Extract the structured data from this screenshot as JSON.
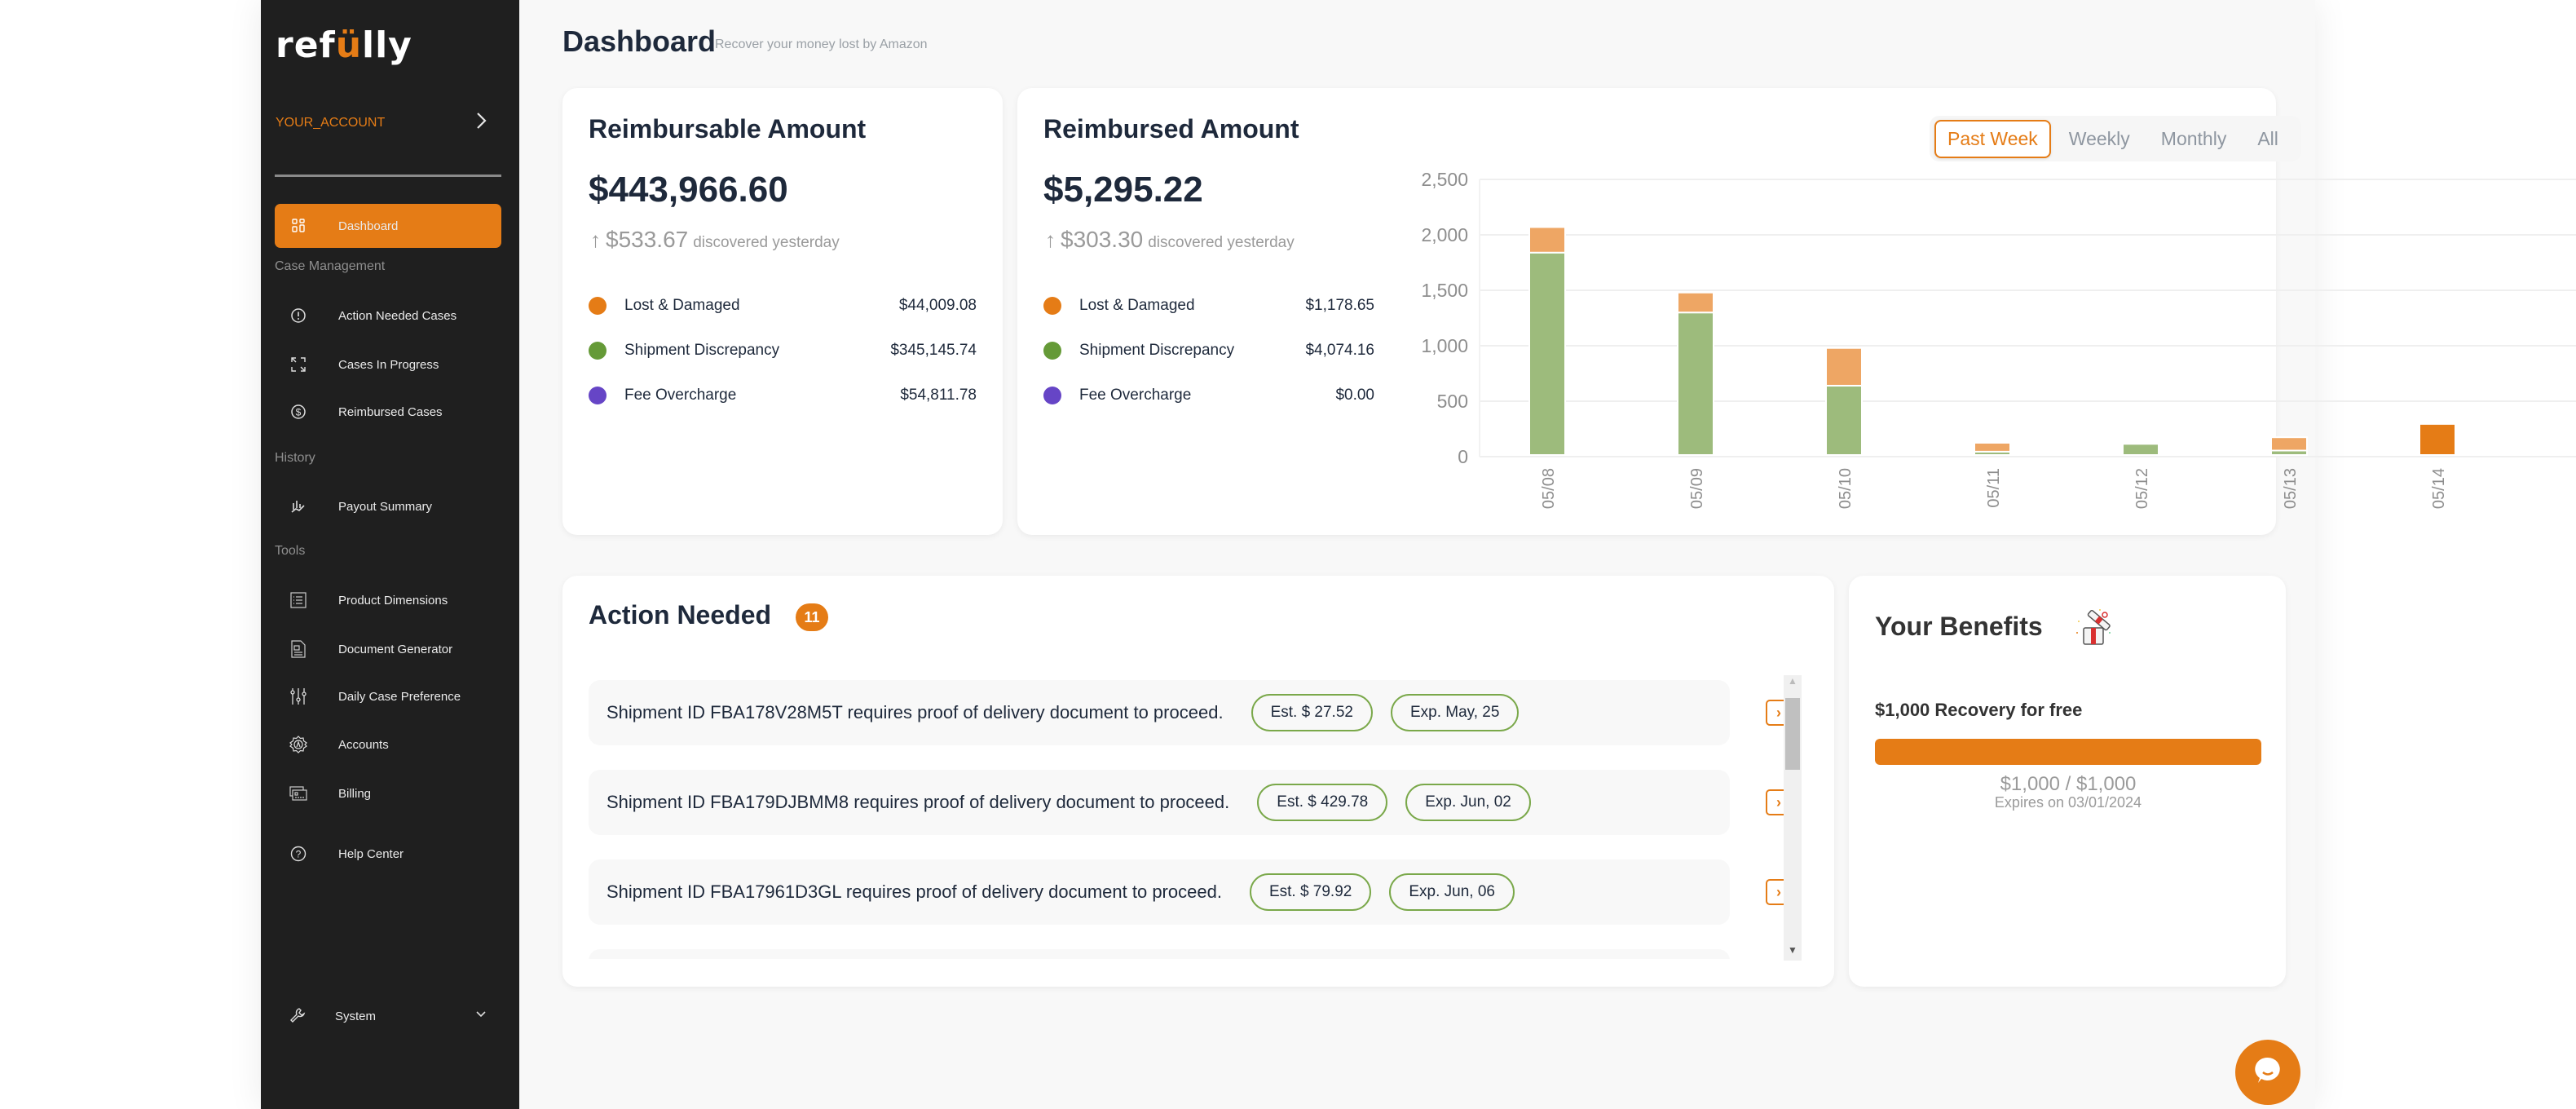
{
  "brand": {
    "logo_prefix": "ref",
    "logo_accent": "ü",
    "logo_suffix": "lly"
  },
  "sidebar": {
    "account_name": "YOUR_ACCOUNT",
    "active_item": {
      "label": "Dashboard",
      "icon": "grid-icon"
    },
    "sections": [
      {
        "label": "Case Management",
        "items": [
          {
            "label": "Action Needed Cases",
            "icon": "alert-circle-icon"
          },
          {
            "label": "Cases In Progress",
            "icon": "arrows-in-progress-icon"
          },
          {
            "label": "Reimbursed Cases",
            "icon": "dollar-circle-icon"
          }
        ]
      },
      {
        "label": "History",
        "items": [
          {
            "label": "Payout Summary",
            "icon": "chart-trend-icon"
          }
        ]
      },
      {
        "label": "Tools",
        "items": [
          {
            "label": "Product Dimensions",
            "icon": "list-icon"
          },
          {
            "label": "Document Generator",
            "icon": "document-icon"
          },
          {
            "label": "Daily Case Preference",
            "icon": "sliders-icon"
          },
          {
            "label": "Accounts",
            "icon": "account-gear-icon"
          },
          {
            "label": "Billing",
            "icon": "billing-card-icon"
          }
        ]
      }
    ],
    "help": {
      "label": "Help Center",
      "icon": "help-circle-icon"
    },
    "system": {
      "label": "System",
      "icon": "wrench-icon"
    }
  },
  "header": {
    "title": "Dashboard",
    "subtitle": "Recover your money lost by Amazon"
  },
  "reimbursable": {
    "title": "Reimbursable Amount",
    "amount": "$443,966.60",
    "delta_amount": "$533.67",
    "delta_text": "discovered yesterday",
    "breakdown": [
      {
        "label": "Lost & Damaged",
        "value": "$44,009.08",
        "color": "#e57c16"
      },
      {
        "label": "Shipment Discrepancy",
        "value": "$345,145.74",
        "color": "#659a37"
      },
      {
        "label": "Fee Overcharge",
        "value": "$54,811.78",
        "color": "#6645c6"
      }
    ]
  },
  "reimbursed": {
    "title": "Reimbursed Amount",
    "amount": "$5,295.22",
    "delta_amount": "$303.30",
    "delta_text": "discovered yesterday",
    "breakdown": [
      {
        "label": "Lost & Damaged",
        "value": "$1,178.65",
        "color": "#e57c16"
      },
      {
        "label": "Shipment Discrepancy",
        "value": "$4,074.16",
        "color": "#659a37"
      },
      {
        "label": "Fee Overcharge",
        "value": "$0.00",
        "color": "#6645c6"
      }
    ],
    "tabs": [
      {
        "label": "Past Week",
        "active": true
      },
      {
        "label": "Weekly",
        "active": false
      },
      {
        "label": "Monthly",
        "active": false
      },
      {
        "label": "All",
        "active": false
      }
    ]
  },
  "chart_data": {
    "type": "bar",
    "stacked": true,
    "title": "",
    "xlabel": "",
    "ylabel": "",
    "categories": [
      "05/08",
      "05/09",
      "05/10",
      "05/11",
      "05/12",
      "05/13",
      "05/14"
    ],
    "series": [
      {
        "name": "Shipment Discrepancy",
        "color": "#9dbb7c",
        "values": [
          1840,
          1300,
          640,
          45,
          115,
          55,
          0
        ]
      },
      {
        "name": "Lost & Damaged",
        "color": "#eea664",
        "highlight_color": "#e57c16",
        "values": [
          230,
          180,
          340,
          80,
          0,
          120,
          295
        ]
      }
    ],
    "highlighted_category": "05/14",
    "ylim": [
      0,
      2500
    ],
    "yticks": [
      0,
      500,
      1000,
      1500,
      2000,
      2500
    ],
    "ytick_labels": [
      "0",
      "500",
      "1,000",
      "1,500",
      "2,000",
      "2,500"
    ],
    "grid": true,
    "legend": "none"
  },
  "action_needed": {
    "title": "Action Needed",
    "count": "11",
    "items": [
      {
        "message": "Shipment ID FBA178V28M5T requires proof of delivery document to proceed.",
        "estimate": "Est. $ 27.52",
        "expires": "Exp. May, 25"
      },
      {
        "message": "Shipment ID FBA179DJBMM8 requires proof of delivery document to proceed.",
        "estimate": "Est. $ 429.78",
        "expires": "Exp. Jun, 02"
      },
      {
        "message": "Shipment ID FBA17961D3GL requires proof of delivery document to proceed.",
        "estimate": "Est. $ 79.92",
        "expires": "Exp. Jun, 06"
      },
      {
        "message": "",
        "estimate": "",
        "expires": ""
      }
    ]
  },
  "benefits": {
    "title": "Your Benefits",
    "offer": "$1,000 Recovery for free",
    "progress_fraction": 1.0,
    "progress_text": "$1,000 / $1,000",
    "expires": "Expires on 03/01/2024"
  },
  "colors": {
    "accent": "#e57c16",
    "sidebar_bg": "#1f1f1f",
    "pill_border": "#7aa84a"
  }
}
